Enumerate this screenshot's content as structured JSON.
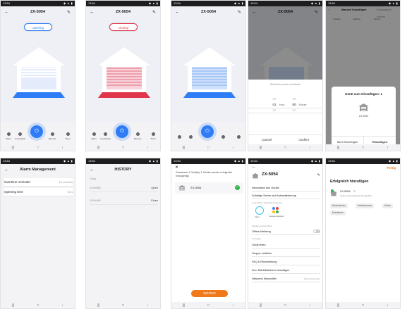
{
  "status": {
    "time": "13:54",
    "icons": "◆ ▲ ▮"
  },
  "nav": {
    "menu": "|||",
    "home": "□",
    "back": "‹"
  },
  "device": {
    "name": "ZX-5054"
  },
  "colors": {
    "blue": "#2e7df6",
    "red": "#e0354a",
    "orange": "#f07a1b",
    "green": "#2fb34a"
  },
  "toolbar": {
    "items": [
      "Alarm",
      "Countdown",
      "Remote",
      "Timer"
    ],
    "history": "History"
  },
  "screen1": {
    "status_pill": "opening"
  },
  "screen2": {
    "status_pill": "closing"
  },
  "screen4": {
    "title": "Set device close countdown",
    "picker_cols": [
      [
        "00",
        "01",
        "02"
      ],
      [
        "59",
        "00",
        "01"
      ]
    ],
    "picker_units": [
      "Hour",
      "Minute"
    ],
    "cancel": "Cancel",
    "confirm": "confirm"
  },
  "screen5": {
    "tab_title": "Manuell hinzufügen",
    "tab_right": "Automatisch suchen",
    "categories": [
      "Sockets",
      "Lighting",
      "Sensor"
    ],
    "dialog_title": "Gerät zum Hinzufügen: 1",
    "device": "ZX-5054",
    "no_add": "Nicht hinzufügen",
    "add": "Hinzufügen"
  },
  "screen6": {
    "title": "Alarm Management",
    "rows": [
      {
        "label": "Overtime reminder",
        "value": "10 minutes"
      },
      {
        "label": "Opening time",
        "value": "30 s"
      }
    ]
  },
  "screen7": {
    "title": "HISTORY",
    "day": "Today",
    "entries": [
      {
        "time": "13:54:55",
        "action": "Open"
      },
      {
        "time": "13:54:45",
        "action": "Close"
      }
    ]
  },
  "screen8": {
    "message": "Gescannte 1 Gerät(e) 1 Geräte wurden erfolgreich hinzugefügt",
    "device": "ZX-5054",
    "next": "WEITER"
  },
  "screen9": {
    "device": "ZX-5054",
    "rows_top": [
      "Information des Geräts",
      "Sofortige Szene und Automatisierung"
    ],
    "third_party_label": "Unterstützte Drittanbieterdienste",
    "services": [
      "Alexa",
      "Google Assistant"
    ],
    "offline_label": "Meldung Gerät offline",
    "offline_toggle": "Offline-Meldung",
    "others_label": "Sonstiges",
    "rows_bottom": [
      "Gerät teilen",
      "Gruppe erstellen",
      "FAQ & Rückmeldung",
      "Zum Startbildschirm hinzufügen",
      "Netzwerk überprüfen"
    ],
    "network_value": "Sofort überprüfen"
  },
  "screen10": {
    "done": "Fertig",
    "title": "Erfolgreich hinzufügen",
    "device": "ZX-5054",
    "sub": "Gerät wurde erfolgreich hinzugefügt",
    "rooms": [
      "Wohnzimmer",
      "Arbeitszimmer",
      "Küche",
      "Esszimmer"
    ]
  }
}
